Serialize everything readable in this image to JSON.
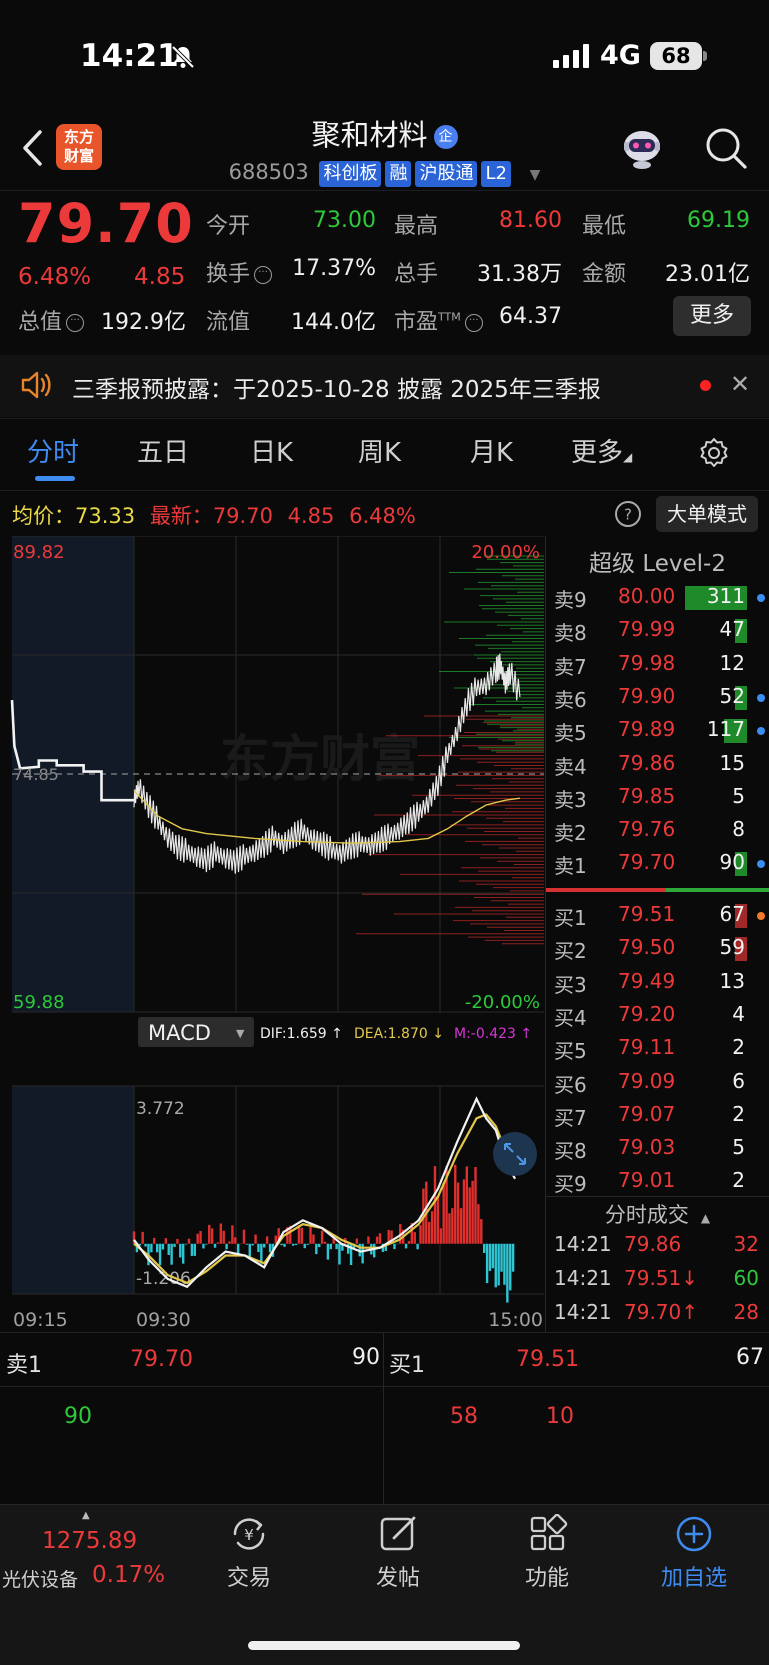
{
  "status_bar": {
    "time": "14:21",
    "network": "4G",
    "battery": "68"
  },
  "header": {
    "app_logo": "东方财富",
    "stock_name": "聚和材料",
    "ent_badge": "企",
    "code": "688503",
    "tags": [
      "科创板",
      "融",
      "沪股通",
      "L2"
    ]
  },
  "quote": {
    "price": "79.70",
    "change_pct": "6.48%",
    "change": "4.85",
    "open_label": "今开",
    "open": "73.00",
    "high_label": "最高",
    "high": "81.60",
    "low_label": "最低",
    "low": "69.19",
    "turnover_label": "换手",
    "turnover": "17.37%",
    "volume_label": "总手",
    "volume": "31.38万",
    "amount_label": "金额",
    "amount": "23.01亿",
    "total_mv_label": "总值",
    "total_mv": "192.9亿",
    "float_mv_label": "流值",
    "float_mv": "144.0亿",
    "pe_label": "市盈",
    "pe_sup": "TTM",
    "pe": "64.37",
    "more_button": "更多"
  },
  "notice": {
    "text": "三季报预披露：于2025-10-28 披露 2025年三季报"
  },
  "tabs": [
    {
      "label": "分时",
      "active": true
    },
    {
      "label": "五日"
    },
    {
      "label": "日K"
    },
    {
      "label": "周K"
    },
    {
      "label": "月K"
    },
    {
      "label": "更多"
    }
  ],
  "info_line": {
    "avg_label": "均价：",
    "avg": "73.33",
    "latest_label": "最新：",
    "latest": "79.70",
    "change": "4.85",
    "change_pct": "6.48%",
    "big_order_button": "大单模式"
  },
  "chart_data": {
    "type": "line",
    "title": "",
    "y_max_label": "89.82",
    "y_min_label": "59.88",
    "pct_max_label": "20.00%",
    "pct_min_label": "-20.00%",
    "prev_close_label": "74.85",
    "ylim": [
      59.88,
      89.82
    ],
    "prev_close": 74.85,
    "x_labels": [
      "09:15",
      "09:30",
      "15:00"
    ],
    "watermark": "东方财富",
    "price_series": [
      [
        0,
        79.5
      ],
      [
        0.6,
        77.2
      ],
      [
        1.2,
        75.2
      ],
      [
        2,
        75.3
      ],
      [
        4,
        75.6
      ],
      [
        6,
        75.7
      ],
      [
        8,
        75.4
      ],
      [
        10,
        75.3
      ],
      [
        12,
        75.0
      ],
      [
        14,
        74.6
      ],
      [
        15,
        73.2
      ],
      [
        16,
        74.0
      ],
      [
        18,
        72.8
      ],
      [
        20,
        71.8
      ],
      [
        22,
        70.8
      ],
      [
        24,
        70.2
      ],
      [
        26,
        69.9
      ],
      [
        28,
        69.6
      ],
      [
        30,
        69.4
      ],
      [
        32,
        69.8
      ],
      [
        34,
        69.5
      ],
      [
        36,
        69.3
      ],
      [
        38,
        69.6
      ],
      [
        40,
        69.9
      ],
      [
        42,
        70.3
      ],
      [
        44,
        70.8
      ],
      [
        46,
        70.4
      ],
      [
        48,
        70.9
      ],
      [
        50,
        71.2
      ],
      [
        52,
        70.7
      ],
      [
        54,
        70.4
      ],
      [
        56,
        70.0
      ],
      [
        58,
        69.8
      ],
      [
        60,
        70.2
      ],
      [
        62,
        70.4
      ],
      [
        64,
        70.3
      ],
      [
        66,
        70.6
      ],
      [
        68,
        70.9
      ],
      [
        70,
        71.3
      ],
      [
        72,
        71.8
      ],
      [
        74,
        72.3
      ],
      [
        76,
        73.0
      ],
      [
        78,
        74.2
      ],
      [
        80,
        76.0
      ],
      [
        82,
        77.5
      ],
      [
        84,
        79.2
      ],
      [
        86,
        80.2
      ],
      [
        88,
        80.4
      ],
      [
        90,
        81.3
      ],
      [
        91,
        81.6
      ],
      [
        92,
        80.5
      ],
      [
        93,
        81.2
      ],
      [
        95,
        79.7
      ]
    ],
    "avg_series": [
      [
        15,
        73.8
      ],
      [
        20,
        72.2
      ],
      [
        25,
        71.4
      ],
      [
        30,
        71.1
      ],
      [
        40,
        70.8
      ],
      [
        50,
        70.6
      ],
      [
        60,
        70.5
      ],
      [
        70,
        70.6
      ],
      [
        76,
        70.8
      ],
      [
        80,
        71.4
      ],
      [
        84,
        72.2
      ],
      [
        88,
        72.9
      ],
      [
        92,
        73.2
      ],
      [
        95,
        73.33
      ]
    ],
    "macd": {
      "label": "MACD",
      "dif_label": "DIF:1.659 ↑",
      "dea_label": "DEA:1.870 ↓",
      "m_label": "M:-0.423 ↑",
      "y_max_label": "3.772",
      "y_min_label": "-1.206",
      "ylim": [
        -1.206,
        3.772
      ],
      "dif": [
        [
          15,
          0.1
        ],
        [
          18,
          -0.4
        ],
        [
          22,
          -0.9
        ],
        [
          26,
          -1.1
        ],
        [
          30,
          -0.6
        ],
        [
          34,
          -0.2
        ],
        [
          38,
          -0.3
        ],
        [
          42,
          -0.6
        ],
        [
          46,
          0.3
        ],
        [
          50,
          0.6
        ],
        [
          54,
          0.4
        ],
        [
          58,
          0.0
        ],
        [
          62,
          -0.2
        ],
        [
          66,
          -0.1
        ],
        [
          70,
          0.2
        ],
        [
          74,
          0.6
        ],
        [
          78,
          1.4
        ],
        [
          82,
          2.6
        ],
        [
          86,
          3.7
        ],
        [
          88,
          3.2
        ],
        [
          90,
          2.9
        ],
        [
          92,
          2.1
        ],
        [
          94,
          1.659
        ]
      ],
      "dea": [
        [
          15,
          0.0
        ],
        [
          18,
          -0.3
        ],
        [
          22,
          -0.8
        ],
        [
          26,
          -1.0
        ],
        [
          30,
          -0.7
        ],
        [
          34,
          -0.3
        ],
        [
          38,
          -0.3
        ],
        [
          42,
          -0.5
        ],
        [
          46,
          0.2
        ],
        [
          50,
          0.5
        ],
        [
          54,
          0.4
        ],
        [
          58,
          0.1
        ],
        [
          62,
          -0.1
        ],
        [
          66,
          -0.1
        ],
        [
          70,
          0.1
        ],
        [
          74,
          0.5
        ],
        [
          78,
          1.2
        ],
        [
          82,
          2.3
        ],
        [
          86,
          3.2
        ],
        [
          88,
          3.3
        ],
        [
          90,
          3.0
        ],
        [
          92,
          2.4
        ],
        [
          94,
          1.87
        ]
      ]
    }
  },
  "level2": {
    "title": "超级 Level-2",
    "asks": [
      {
        "label": "卖9",
        "price": "80.00",
        "vol": "311",
        "bar": 0.95,
        "dot": "#3a8ef0"
      },
      {
        "label": "卖8",
        "price": "79.99",
        "vol": "47",
        "bar": 0.18,
        "dot": ""
      },
      {
        "label": "卖7",
        "price": "79.98",
        "vol": "12",
        "bar": 0.0,
        "dot": ""
      },
      {
        "label": "卖6",
        "price": "79.90",
        "vol": "52",
        "bar": 0.18,
        "dot": "#3a8ef0"
      },
      {
        "label": "卖5",
        "price": "79.89",
        "vol": "117",
        "bar": 0.35,
        "dot": "#3a8ef0"
      },
      {
        "label": "卖4",
        "price": "79.86",
        "vol": "15",
        "bar": 0.0,
        "dot": ""
      },
      {
        "label": "卖3",
        "price": "79.85",
        "vol": "5",
        "bar": 0.0,
        "dot": ""
      },
      {
        "label": "卖2",
        "price": "79.76",
        "vol": "8",
        "bar": 0.0,
        "dot": ""
      },
      {
        "label": "卖1",
        "price": "79.70",
        "vol": "90",
        "bar": 0.18,
        "dot": "#3a8ef0"
      }
    ],
    "bids": [
      {
        "label": "买1",
        "price": "79.51",
        "vol": "67",
        "bar": 0.18,
        "dot": "#f07a2a"
      },
      {
        "label": "买2",
        "price": "79.50",
        "vol": "59",
        "bar": 0.18,
        "dot": ""
      },
      {
        "label": "买3",
        "price": "79.49",
        "vol": "13",
        "bar": 0.0,
        "dot": ""
      },
      {
        "label": "买4",
        "price": "79.20",
        "vol": "4",
        "bar": 0.0,
        "dot": ""
      },
      {
        "label": "买5",
        "price": "79.11",
        "vol": "2",
        "bar": 0.0,
        "dot": ""
      },
      {
        "label": "买6",
        "price": "79.09",
        "vol": "6",
        "bar": 0.0,
        "dot": ""
      },
      {
        "label": "买7",
        "price": "79.07",
        "vol": "2",
        "bar": 0.0,
        "dot": ""
      },
      {
        "label": "买8",
        "price": "79.03",
        "vol": "5",
        "bar": 0.0,
        "dot": ""
      },
      {
        "label": "买9",
        "price": "79.01",
        "vol": "2",
        "bar": 0.0,
        "dot": ""
      }
    ],
    "ticks_title": "分时成交",
    "ticks": [
      {
        "time": "14:21",
        "price": "79.86",
        "vol": "32",
        "dir": "",
        "pcolor": "#ec3a3a",
        "vcolor": "#ec3a3a"
      },
      {
        "time": "14:21",
        "price": "79.51↓",
        "vol": "60",
        "dir": "down",
        "pcolor": "#ec3a3a",
        "vcolor": "#2ec93a"
      },
      {
        "time": "14:21",
        "price": "79.70↑",
        "vol": "28",
        "dir": "up",
        "pcolor": "#ec3a3a",
        "vcolor": "#ec3a3a"
      }
    ]
  },
  "summary": {
    "ask_label": "卖1",
    "ask_price": "79.70",
    "ask_vol": "90",
    "bid_label": "买1",
    "bid_price": "79.51",
    "bid_vol": "67",
    "ask_detail": "90",
    "bid_detail_1": "58",
    "bid_detail_2": "10"
  },
  "bottom_nav": {
    "index_value": "1275.89",
    "index_name": "光伏设备",
    "index_pct": "0.17%",
    "items": [
      "交易",
      "发帖",
      "功能",
      "加自选"
    ]
  }
}
